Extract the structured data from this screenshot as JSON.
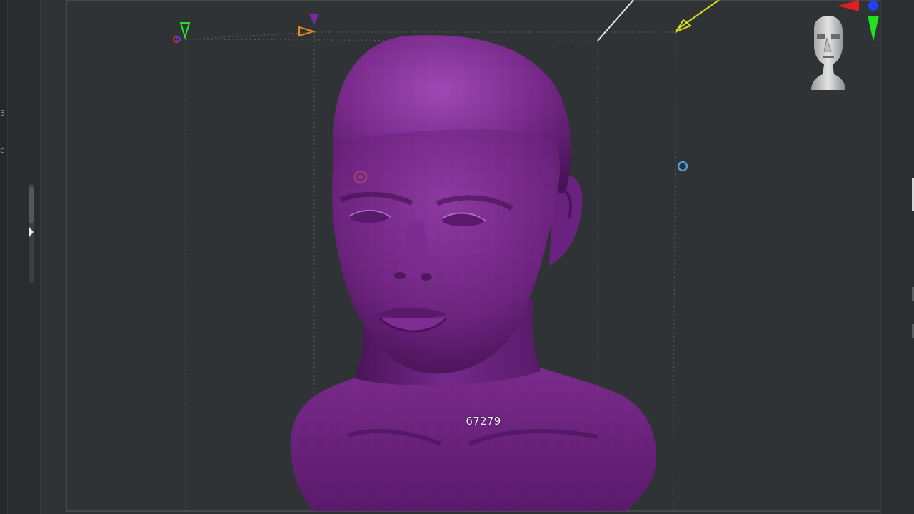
{
  "app": {
    "kind": "3d-sculpting-viewport"
  },
  "viewport": {
    "model": "purple-sculpted-head-bust",
    "model_color": "#7a2a8c",
    "background_color": "#303335",
    "poly_count": "67279",
    "cursor_indicator_color": "#4aa3e0"
  },
  "left_shelf": {
    "frag_a": "3",
    "frag_b": "c"
  },
  "gizmo": {
    "x_axis_color": "#e02020",
    "y_axis_color": "#20e020",
    "z_axis_color": "#2040ff"
  }
}
